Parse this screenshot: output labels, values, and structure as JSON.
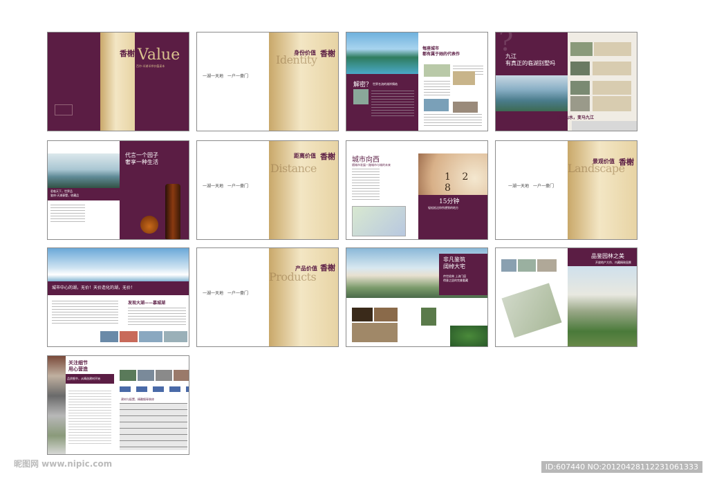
{
  "brochure": {
    "brand_logo": "香榭",
    "slogan": "一湖一天地　一户一豪门",
    "p1": {
      "big": "Value",
      "sub": "百尔·半湖半岸价值读本"
    },
    "p2": {
      "cn": "身份价值",
      "en": "Identity"
    },
    "p3": {
      "headline": "每座城市\n都有属于她的代表作",
      "bar": "解密？",
      "bar_sub": "世界名流的湖岸情结"
    },
    "p4": {
      "headline": "九江\n有真正的临湖别墅吗",
      "foot": "变美山水，变马九江"
    },
    "p5": {
      "headline": "代言一个园子\n奢享一种生活",
      "caption": "君临天下，世界品\n鉴府·天湖豪墅，收藏品"
    },
    "p6": {
      "cn": "距离价值",
      "en": "Distance"
    },
    "p7": {
      "headline": "城市向西",
      "sub": "随城市发展一路城市与城的未来",
      "time": "15分钟",
      "time_sub": "轻松抵达你所想到的地方"
    },
    "p8": {
      "cn": "景观价值",
      "en": "Landscape"
    },
    "p9": {
      "headline": "城市中心的湖，无价！天价造化的湖，无价！",
      "sub": "发现大湖——慕城湖"
    },
    "p10": {
      "cn": "产品价值",
      "en": "Products"
    },
    "p11": {
      "headline": "非凡鉴筑\n阔绰大宅",
      "sub": "传世经典 上流门庭\n得意之居的完美奢藏"
    },
    "p12": {
      "headline": "品鉴园林之美",
      "sub": "开放地产大作、内藏精致园景"
    },
    "p13": {
      "headline": "关注细节\n用心营造",
      "sub": "品质细节，从精选建材开始",
      "table": "建材与配置、精雕细琢装修"
    }
  },
  "watermark": "昵图网 www.nipic.com",
  "image_id": "ID:607440 NO:20120428112231061333"
}
